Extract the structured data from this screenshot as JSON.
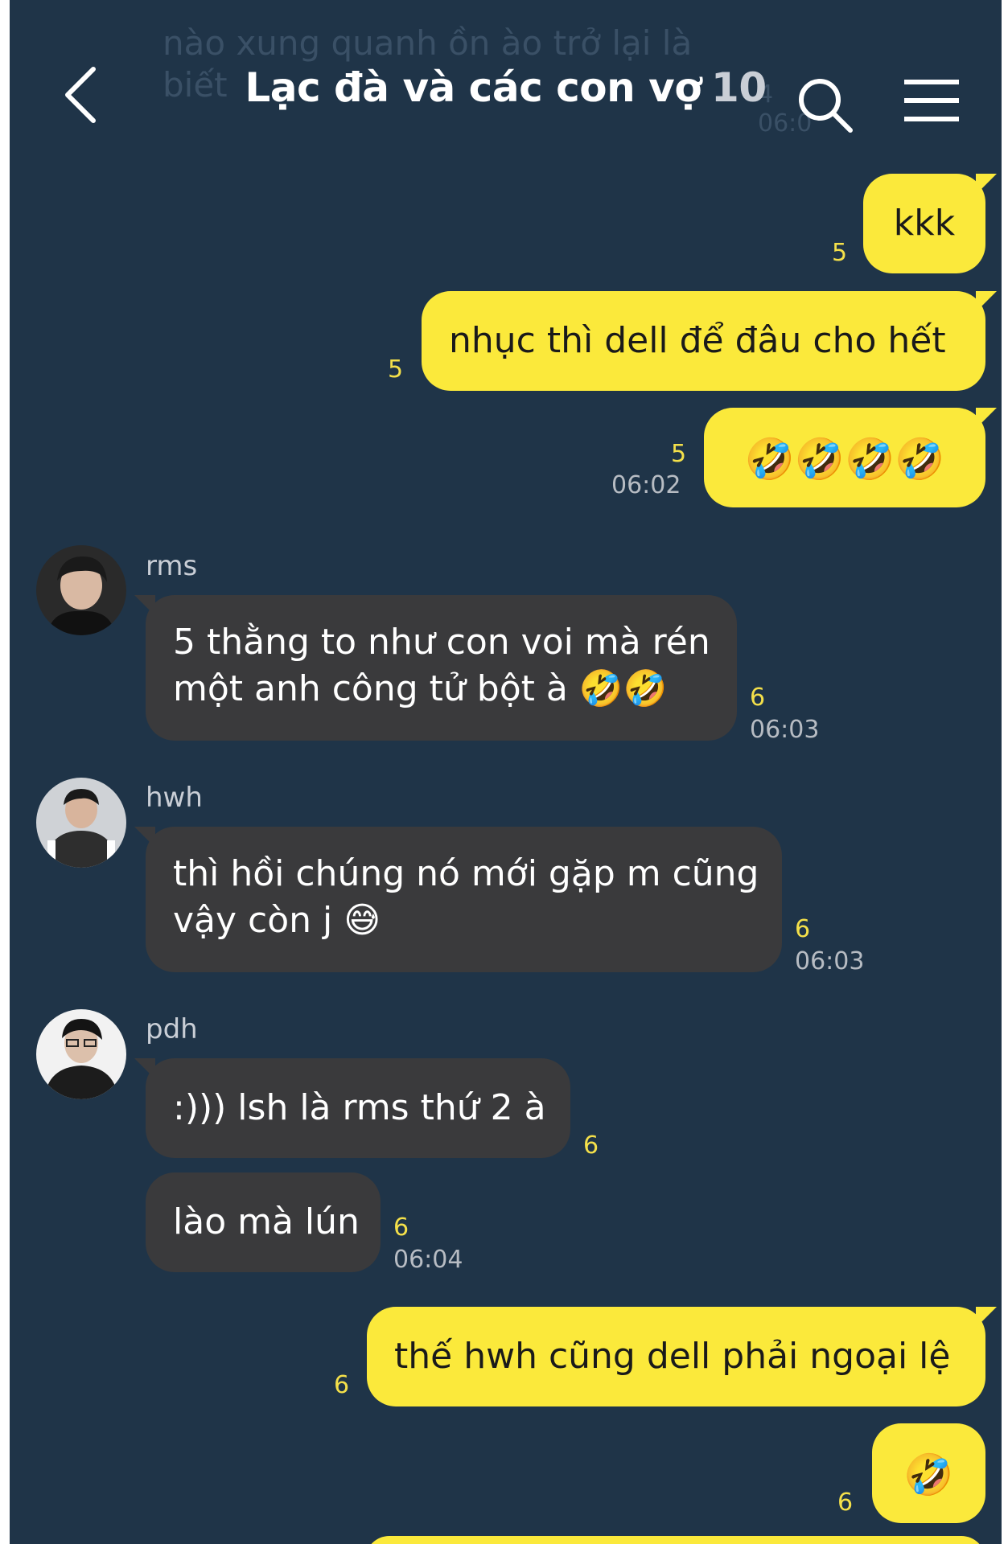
{
  "header": {
    "title": "Lạc đà và các con vợ",
    "member_count": "10",
    "ghost_text": "nào xung quanh ồn ào trở lại là biết",
    "ghost_meta_count": "4",
    "ghost_meta_time": "06:0"
  },
  "icons": {
    "back": "chevron-left-icon",
    "search": "search-icon",
    "menu": "hamburger-menu-icon"
  },
  "colors": {
    "background": "#1f3448",
    "my_bubble": "#fbe93b",
    "their_bubble": "#3a3a3c",
    "unread_count": "#f4e04a"
  },
  "messages": [
    {
      "text": "kkk",
      "unread": "5"
    },
    {
      "text": "nhục thì dell để đâu cho hết",
      "unread": "5"
    },
    {
      "text": "🤣🤣🤣🤣",
      "unread": "5",
      "time": "06:02"
    },
    {
      "sender": "rms",
      "line1": "5 thằng to như con voi mà rén",
      "line2": "một anh công tử bột à 🤣🤣",
      "unread": "6",
      "time": "06:03"
    },
    {
      "sender": "hwh",
      "line1": "thì hồi chúng nó mới gặp m cũng",
      "line2": "vậy còn j 😅",
      "unread": "6",
      "time": "06:03"
    },
    {
      "sender": "pdh",
      "text": ":))) lsh là rms thứ 2 à",
      "unread": "6"
    },
    {
      "text": "lào mà lún",
      "unread": "6",
      "time": "06:04"
    },
    {
      "text": "thế hwh cũng dell phải ngoại lệ",
      "unread": "6"
    },
    {
      "text": "🤣",
      "unread": "6"
    }
  ]
}
